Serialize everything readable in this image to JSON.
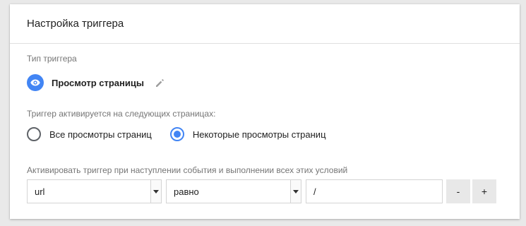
{
  "card": {
    "title": "Настройка триггера"
  },
  "trigger_type": {
    "label": "Тип триггера",
    "name": "Просмотр страницы",
    "icon": "eye-icon"
  },
  "activation": {
    "label": "Триггер активируется на следующих страницах:",
    "options": [
      {
        "label": "Все просмотры страниц",
        "checked": false
      },
      {
        "label": "Некоторые просмотры страниц",
        "checked": true
      }
    ]
  },
  "conditions": {
    "label": "Активировать триггер при наступлении события и выполнении всех этих условий",
    "variable": "url",
    "operator": "равно",
    "value": "/",
    "remove_label": "-",
    "add_label": "+"
  },
  "colors": {
    "accent": "#4285f4",
    "background": "#e9e9e9",
    "card": "#ffffff"
  }
}
